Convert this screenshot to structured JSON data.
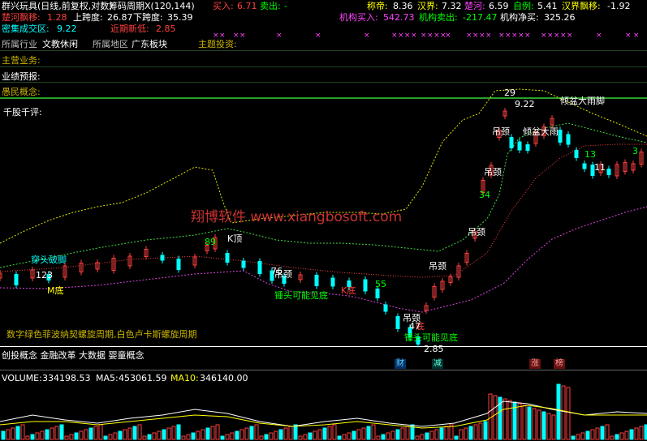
{
  "header": {
    "stock_name": "群兴玩具(日线,前复权,对数)",
    "indicator": "筹码周期X(120,144)",
    "buy_in_label": "买入:",
    "buy_in_value": "6.71",
    "sell_out_label": "卖出:",
    "sell_out_value": "-",
    "chengdi_label": "称帝:",
    "chengdi_value": "8.36",
    "hanjie_label": "汉界:",
    "hanjie_value": "7.32",
    "chuhe_label": "楚河:",
    "chuhe_value": "6.59",
    "ziyou_label": "自例:",
    "ziyou_value": "5.41",
    "hanjie_drift_label": "汉界飘移:",
    "hanjie_drift_value": "-1.92",
    "chuhe_drift_label": "楚河飘移:",
    "chuhe_drift_value": "1.28",
    "up_span_label": "上跨度:",
    "up_span_value": "26.87",
    "down_span_label": "下跨度:",
    "down_span_value": "35.39",
    "inst_buy_label": "机构买入:",
    "inst_buy_value": "542.73",
    "inst_sell_label": "机构卖出:",
    "inst_sell_value": "-217.47",
    "inst_net_label": "机构净买:",
    "inst_net_value": "325.26",
    "dense_zone_label": "密集成交区:",
    "dense_zone_value": "9.22",
    "recent_low_label": "近期新低:",
    "recent_low_value": "2.85"
  },
  "info_panel": {
    "industry_label": "所属行业",
    "industry_value": "文教休闲",
    "region_label": "所属地区",
    "region_value": "广东板块",
    "theme_label": "主题投资:",
    "main_business_label": "主营业务:",
    "forecast_label": "业绩预报:",
    "concept_label": "愚民概念:",
    "comment_label": "千股千评:"
  },
  "annotations": {
    "watermark": "翔博软件 www.xiangbosoft.com",
    "fib_note": "数字绿色菲波纳契螺旋周期,白色卢卡斯螺旋周期",
    "concepts": "创投概念 金融改革 大数据 婴童概念",
    "chuantou": "穿头破脚",
    "m_di": "M底",
    "k_top": "K顶",
    "k_bottom": "K底",
    "chuizi_1": "锤头可能见底",
    "chuizi_2": "锤头可能见底",
    "diaojing_1": "吊颈",
    "diaojing_2": "吊颈",
    "diaojing_3": "吊颈",
    "diaojing_4": "吊颈",
    "diaojing_5": "吊颈",
    "qingpen": "倾盆大雨",
    "qingpen_2": "倾盆大雨脚",
    "di_mark": "底",
    "price_high": "9.22",
    "price_low": "2.85",
    "num_29": "29",
    "num_34": "34",
    "num_13": "13",
    "num_11": "11",
    "num_3": "3",
    "num_89": "89",
    "num_76": "76",
    "num_55": "55",
    "num_123": "123",
    "num_47": "47"
  },
  "event_badges": {
    "cai": "财",
    "jian": "减",
    "zhang": "涨",
    "bang": "榜"
  },
  "volume_panel": {
    "volume_label": "VOLUME:",
    "volume_value": "334198.53",
    "ma5_label": "MA5:",
    "ma5_value": "453061.59",
    "ma10_label": "MA10:",
    "ma10_value": "346140.00"
  },
  "colors": {
    "up": "#ff4040",
    "down": "#00ffff",
    "green": "#00ff00",
    "magenta": "#ff44ff",
    "yellow": "#ffff00"
  }
}
